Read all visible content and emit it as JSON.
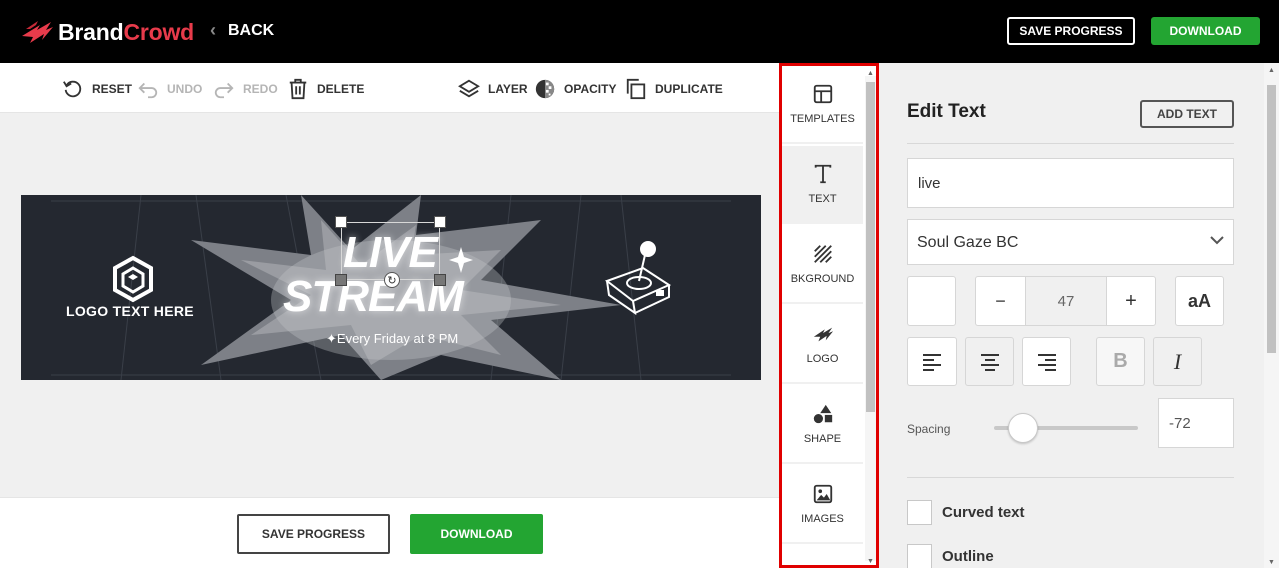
{
  "brand": {
    "name_part1": "Brand",
    "name_part2": "Crowd",
    "accent_color": "#e83b4b"
  },
  "header": {
    "back_label": "BACK",
    "save_label": "SAVE PROGRESS",
    "download_label": "DOWNLOAD"
  },
  "toolbar": {
    "reset": "RESET",
    "undo": "UNDO",
    "redo": "REDO",
    "delete": "DELETE",
    "layer": "LAYER",
    "opacity": "OPACITY",
    "duplicate": "DUPLICATE"
  },
  "canvas": {
    "logo_text": "LOGO TEXT HERE",
    "title_line1": "LIVE",
    "title_line2": "STREAM",
    "subtitle": "✦Every Friday at 8 PM",
    "background_color": "#242830"
  },
  "bottom": {
    "save_label": "SAVE PROGRESS",
    "download_label": "DOWNLOAD"
  },
  "sidebar": {
    "items": [
      {
        "label": "TEMPLATES",
        "icon": "templates-icon"
      },
      {
        "label": "TEXT",
        "icon": "text-icon"
      },
      {
        "label": "BKGROUND",
        "icon": "background-icon"
      },
      {
        "label": "LOGO",
        "icon": "logo-icon"
      },
      {
        "label": "SHAPE",
        "icon": "shape-icon"
      },
      {
        "label": "IMAGES",
        "icon": "images-icon"
      }
    ]
  },
  "panel": {
    "title": "Edit Text",
    "add_text_label": "ADD TEXT",
    "text_value": "live",
    "font_name": "Soul Gaze BC",
    "font_size": "47",
    "case_label": "aA",
    "bold_label": "B",
    "italic_label": "I",
    "spacing_label": "Spacing",
    "spacing_value": "-72",
    "curved_text_label": "Curved text",
    "outline_label": "Outline"
  },
  "colors": {
    "green": "#23a532",
    "highlight_red": "#e00000"
  }
}
